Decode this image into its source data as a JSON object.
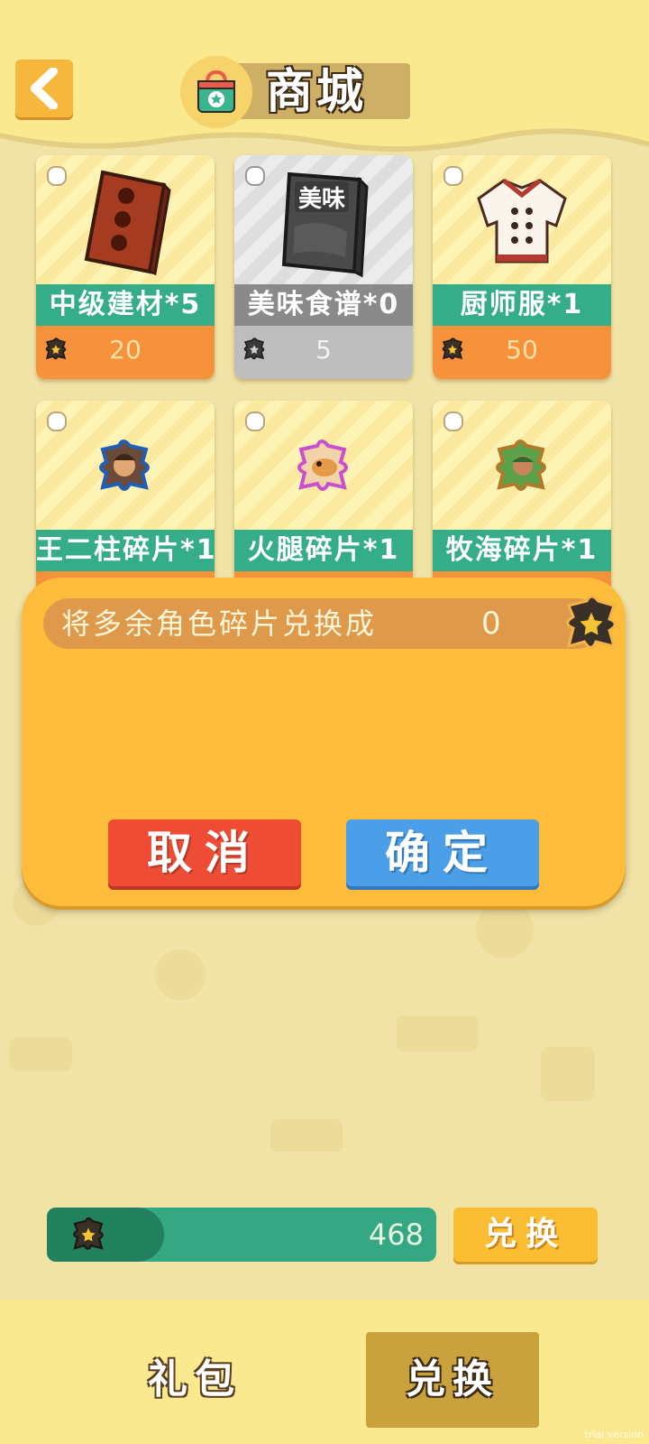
{
  "header": {
    "title": "商城"
  },
  "cards": [
    {
      "name": "中级建材*5",
      "price": "20",
      "state": "normal",
      "art": "brick-icon"
    },
    {
      "name": "美味食谱*0",
      "price": "5",
      "state": "disabled",
      "art": "recipe-book-icon",
      "art_text": "美味"
    },
    {
      "name": "厨师服*1",
      "price": "50",
      "state": "normal",
      "art": "chef-coat-icon"
    },
    {
      "name": "王二柱碎片*1",
      "state": "normal",
      "art": "puzzle-fragment-icon"
    },
    {
      "name": "火腿碎片*1",
      "state": "normal",
      "art": "puzzle-fragment-icon"
    },
    {
      "name": "牧海碎片*1",
      "state": "normal",
      "art": "puzzle-fragment-icon"
    }
  ],
  "dialog": {
    "label": "将多余角色碎片兑换成",
    "value": "0",
    "cancel_label": "取消",
    "confirm_label": "确定"
  },
  "footer": {
    "balance": "468",
    "exchange_label": "兑换"
  },
  "tabs": {
    "gift": "礼包",
    "exchange": "兑换"
  },
  "watermark": "trial version",
  "colors": {
    "accent_green": "#34ad88",
    "price_orange": "#f6913c",
    "dialog_orange": "#fdbc3a",
    "cancel_red": "#ef4c35",
    "confirm_blue": "#4a9fe8"
  }
}
